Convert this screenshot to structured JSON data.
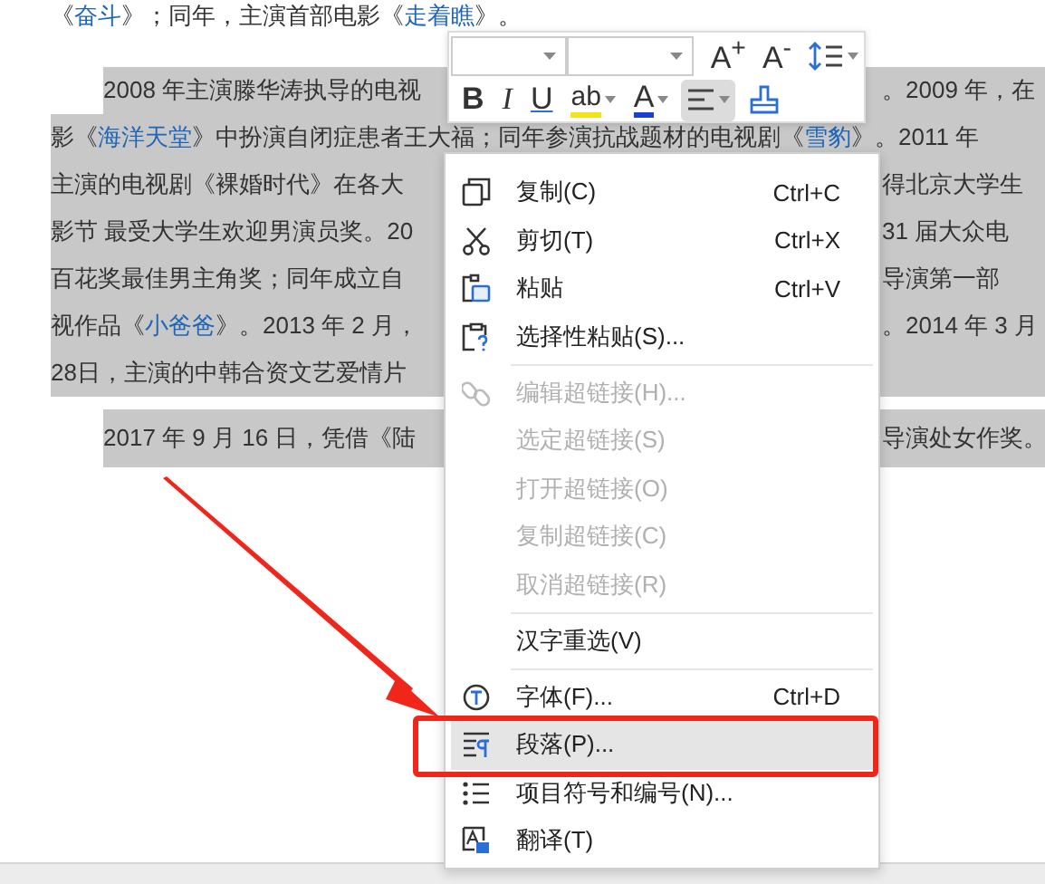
{
  "document": {
    "lines": [
      {
        "indent": false,
        "selected": false,
        "left": [
          {
            "text": "《"
          },
          {
            "link": "奋斗"
          },
          {
            "text": "》；同年，主演首部电影《"
          },
          {
            "link": "走着瞧"
          },
          {
            "text": "》。"
          }
        ]
      },
      {
        "indent": true,
        "selected": true,
        "left": [
          {
            "text": "2008 年主演滕华涛执导的电视"
          }
        ],
        "right": [
          {
            "text": "。2009 年，在"
          }
        ]
      },
      {
        "indent": false,
        "selected": true,
        "left": [
          {
            "text": "影《"
          },
          {
            "link": "海洋天堂"
          },
          {
            "text": "》中扮演自闭症患者王大福；同年参演抗战题材的电视剧《"
          },
          {
            "link": "雪豹"
          },
          {
            "text": "》。2011 年"
          }
        ]
      },
      {
        "indent": false,
        "selected": true,
        "left": [
          {
            "text": "主演的电视剧《裸婚时代》在各大"
          }
        ],
        "right": [
          {
            "text": "得北京大学生"
          }
        ]
      },
      {
        "indent": false,
        "selected": true,
        "left": [
          {
            "text": "影节  最受大学生欢迎男演员奖。20"
          }
        ],
        "right": [
          {
            "text": "31 届大众电"
          }
        ]
      },
      {
        "indent": false,
        "selected": true,
        "left": [
          {
            "text": "百花奖最佳男主角奖；同年成立自"
          }
        ],
        "right": [
          {
            "text": "导演第一部"
          }
        ]
      },
      {
        "indent": false,
        "selected": true,
        "left": [
          {
            "text": "视作品《"
          },
          {
            "link": "小爸爸"
          },
          {
            "text": "》。2013 年 2 月，"
          }
        ],
        "right": [
          {
            "text": "。2014 年 3 月"
          }
        ]
      },
      {
        "indent": false,
        "selected": true,
        "left": [
          {
            "text": "28日，主演的中韩合资文艺爱情片"
          }
        ]
      },
      {
        "indent": true,
        "selected": true,
        "left": [
          {
            "text": "2017 年 9 月 16 日，凭借《陆"
          }
        ],
        "right": [
          {
            "text": "导演处女作奖。"
          }
        ]
      }
    ]
  },
  "toolbar": {
    "rows": [
      [
        {
          "kind": "dropdown"
        },
        {
          "kind": "dropdown"
        },
        {
          "kind": "grow",
          "label": "A$^{+}$",
          "pressed": false
        },
        {
          "kind": "shrink",
          "label": "A$^{-}$",
          "pressed": false
        },
        {
          "kind": "spacing",
          "pressed": false
        }
      ],
      [
        {
          "kind": "bold",
          "label": "B",
          "pressed": false
        },
        {
          "kind": "italic",
          "label": "I",
          "pressed": false
        },
        {
          "kind": "underline",
          "label": "U",
          "pressed": false
        },
        {
          "kind": "highlight",
          "label": "ab",
          "pressed": false
        },
        {
          "kind": "color",
          "label": "A",
          "pressed": false
        },
        {
          "kind": "align",
          "pressed": true
        },
        {
          "kind": "painter",
          "pressed": false
        }
      ]
    ]
  },
  "menu": {
    "items": [
      {
        "kind": "item",
        "label": "复制(C)",
        "shortcut": "Ctrl+C",
        "disabled": false,
        "selected": false
      },
      {
        "kind": "item",
        "label": "剪切(T)",
        "shortcut": "Ctrl+X",
        "disabled": false,
        "selected": false
      },
      {
        "kind": "item",
        "label": "粘贴",
        "shortcut": "Ctrl+V",
        "disabled": false,
        "selected": false
      },
      {
        "kind": "item",
        "label": "选择性粘贴(S)...",
        "disabled": false,
        "selected": false
      },
      {
        "kind": "separator"
      },
      {
        "kind": "item",
        "label": "编辑超链接(H)...",
        "disabled": true,
        "selected": false
      },
      {
        "kind": "item",
        "label": "选定超链接(S)",
        "disabled": true,
        "selected": false
      },
      {
        "kind": "item",
        "label": "打开超链接(O)",
        "disabled": true,
        "selected": false
      },
      {
        "kind": "item",
        "label": "复制超链接(C)",
        "disabled": true,
        "selected": false
      },
      {
        "kind": "item",
        "label": "取消超链接(R)",
        "disabled": true,
        "selected": false
      },
      {
        "kind": "separator"
      },
      {
        "kind": "item",
        "label": "汉字重选(V)",
        "disabled": false,
        "selected": false
      },
      {
        "kind": "separator"
      },
      {
        "kind": "item",
        "label": "字体(F)...",
        "shortcut": "Ctrl+D",
        "disabled": false,
        "selected": false
      },
      {
        "kind": "item",
        "label": "段落(P)...",
        "disabled": false,
        "selected": true
      },
      {
        "kind": "item",
        "label": "项目符号和编号(N)...",
        "disabled": false,
        "selected": false
      },
      {
        "kind": "item",
        "label": "翻译(T)",
        "disabled": false,
        "selected": false
      }
    ]
  }
}
